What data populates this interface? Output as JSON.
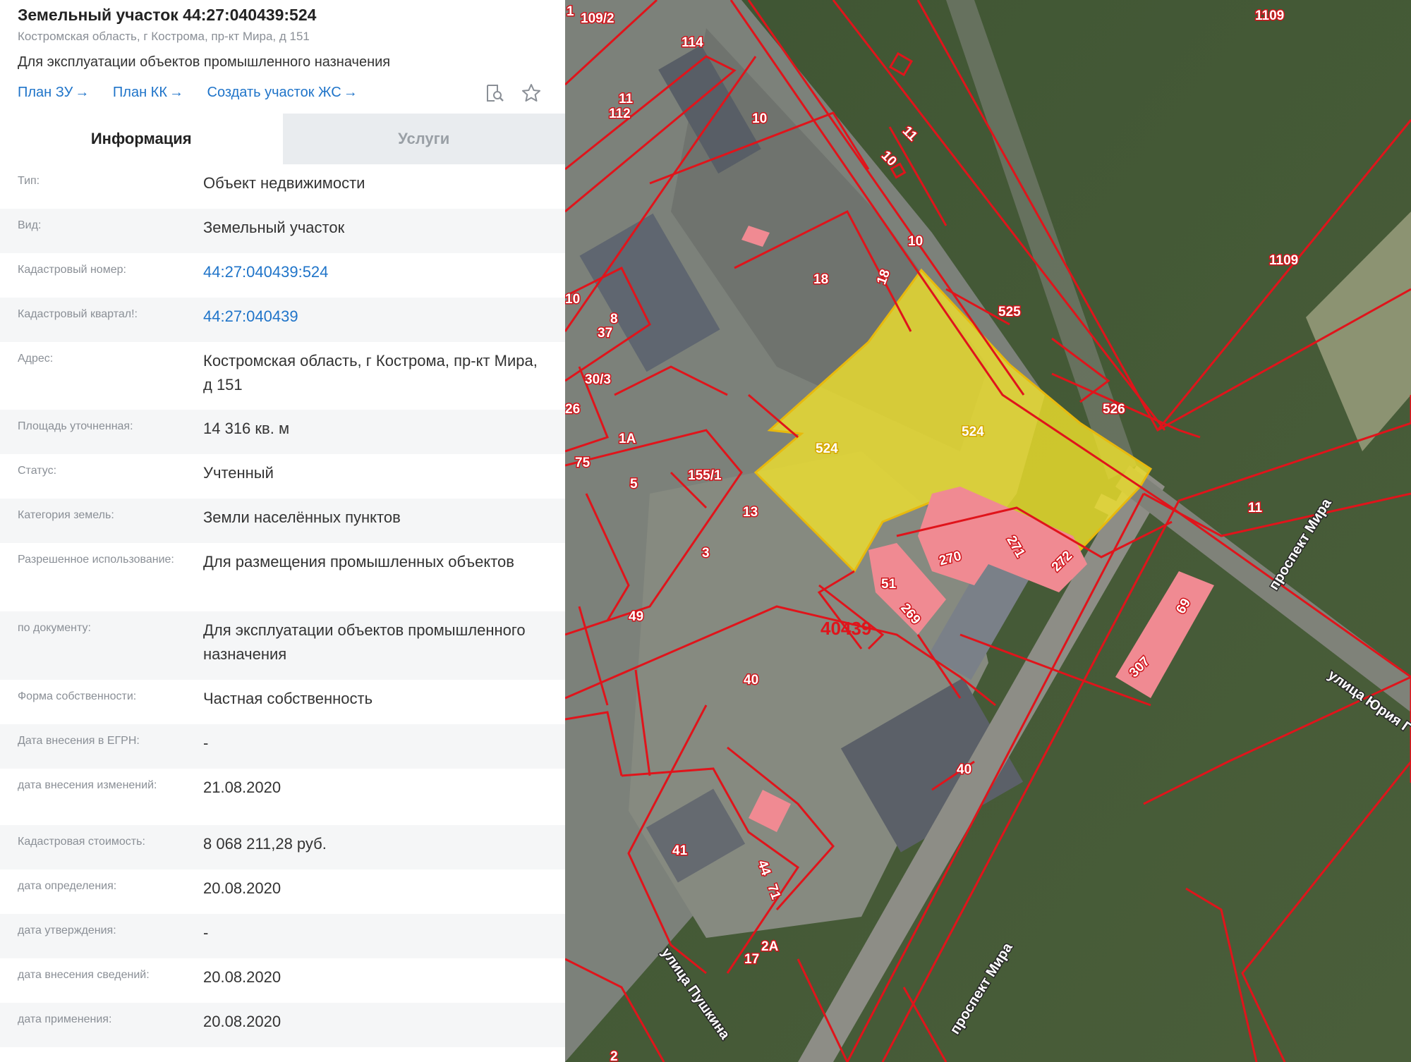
{
  "header": {
    "title": "Земельный участок 44:27:040439:524",
    "address": "Костромская область, г Кострома, пр-кт Мира, д 151",
    "purpose": "Для эксплуатации объектов промышленного назначения",
    "links": [
      {
        "label": "План ЗУ",
        "arrow": "→"
      },
      {
        "label": "План КК",
        "arrow": "→"
      },
      {
        "label": "Создать участок ЖС",
        "arrow": "→"
      }
    ],
    "icons": [
      "search-document-icon",
      "star-icon"
    ]
  },
  "tabs": [
    {
      "label": "Информация",
      "active": true
    },
    {
      "label": "Услуги",
      "active": false
    }
  ],
  "info_rows": [
    {
      "label": "Тип:",
      "value": "Объект недвижимости"
    },
    {
      "label": "Вид:",
      "value": "Земельный участок"
    },
    {
      "label": "Кадастровый номер:",
      "value": "44:27:040439:524",
      "link": true
    },
    {
      "label": "Кадастровый квартал!:",
      "value": "44:27:040439",
      "link": true
    },
    {
      "label": "Адрес:",
      "value": "Костромская область, г Кострома, пр-кт Мира, д 151"
    },
    {
      "label": "Площадь уточненная:",
      "value": "14 316 кв. м"
    },
    {
      "label": "Статус:",
      "value": "Учтенный"
    },
    {
      "label": "Категория земель:",
      "value": "Земли населённых пунктов"
    },
    {
      "label": "Разрешенное использование:",
      "value": "Для размещения промышленных объектов"
    },
    {
      "label": "по документу:",
      "value": "Для эксплуатации объектов промышленного назначения"
    },
    {
      "label": "Форма собственности:",
      "value": "Частная собственность"
    },
    {
      "label": "Дата внесения в ЕГРН:",
      "value": "-"
    },
    {
      "label": "дата внесения изменений:",
      "value": "21.08.2020"
    },
    {
      "label": "Кадастровая стоимость:",
      "value": "8 068 211,28 руб."
    },
    {
      "label": "дата определения:",
      "value": "20.08.2020"
    },
    {
      "label": "дата утверждения:",
      "value": "-"
    },
    {
      "label": "дата внесения сведений:",
      "value": "20.08.2020"
    },
    {
      "label": "дата применения:",
      "value": "20.08.2020"
    }
  ],
  "map": {
    "parcel_labels": [
      "1",
      "109/2",
      "114",
      "1109",
      "11",
      "112",
      "10",
      "11",
      "10",
      "10",
      "18",
      "18",
      "525",
      "1109",
      "10",
      "8",
      "37",
      "30/3",
      "26",
      "1А",
      "75",
      "524",
      "524",
      "526",
      "155/1",
      "5",
      "13",
      "11",
      "3",
      "270",
      "271",
      "272",
      "51",
      "269",
      "49",
      "69",
      "307",
      "40",
      "40",
      "41",
      "44",
      "71",
      "2А",
      "17",
      "2"
    ],
    "quarter_label": "40439",
    "street_labels": [
      "проспект Мира",
      "улица Юрия Г",
      "проспект Мира",
      "улица Пушкина"
    ],
    "colors": {
      "boundary": "#e0141b",
      "selected_fill": "#f3e42a",
      "highlight_fill": "#f08a92"
    }
  }
}
